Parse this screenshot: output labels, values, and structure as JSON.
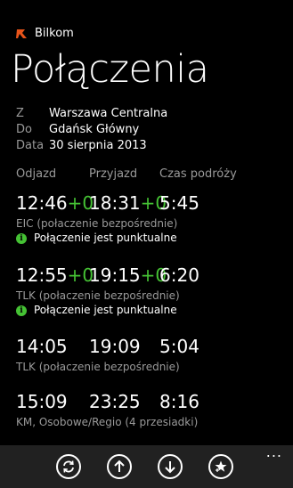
{
  "app": {
    "name": "Bilkom"
  },
  "page": {
    "title": "Połączenia"
  },
  "route": [
    {
      "label": "Z",
      "value": "Warszawa Centralna"
    },
    {
      "label": "Do",
      "value": "Gdańsk Główny"
    },
    {
      "label": "Data",
      "value": "30 sierpnia 2013"
    }
  ],
  "columns": {
    "departure": "Odjazd",
    "arrival": "Przyjazd",
    "duration": "Czas podróży"
  },
  "connections": [
    {
      "departure": "12:46",
      "departure_delay": "+0",
      "arrival": "18:31",
      "arrival_delay": "+0",
      "duration": "5:45",
      "train": "EIC (połaczenie bezpośrednie)",
      "status": "Połączenie jest punktualne"
    },
    {
      "departure": "12:55",
      "departure_delay": "+0",
      "arrival": "19:15",
      "arrival_delay": "+0",
      "duration": "6:20",
      "train": "TLK (połaczenie bezpośrednie)",
      "status": "Połączenie jest punktualne"
    },
    {
      "departure": "14:05",
      "departure_delay": "",
      "arrival": "19:09",
      "arrival_delay": "",
      "duration": "5:04",
      "train": "TLK (połaczenie bezpośrednie)",
      "status": ""
    },
    {
      "departure": "15:09",
      "departure_delay": "",
      "arrival": "23:25",
      "arrival_delay": "",
      "duration": "8:16",
      "train": "KM, Osobowe/Regio (4 przesiadki)",
      "status": ""
    }
  ],
  "appbar": {
    "buttons": [
      "refresh-icon",
      "arrow-up-icon",
      "arrow-down-icon",
      "star-add-icon"
    ],
    "more": "..."
  },
  "colors": {
    "accent": "#45c234",
    "background": "#000000",
    "appbar": "#212121",
    "secondary_text": "#9a9a9a"
  }
}
